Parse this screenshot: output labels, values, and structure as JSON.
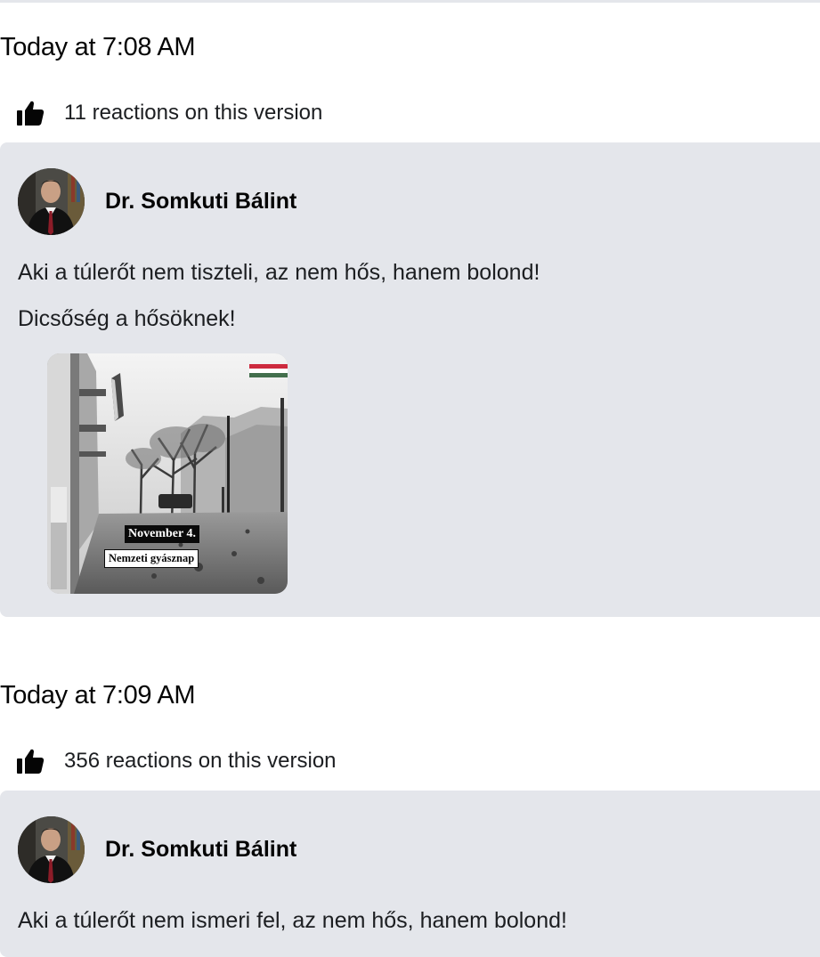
{
  "versions": [
    {
      "timestamp": "Today at 7:08 AM",
      "reactions": "11 reactions on this version",
      "author": "Dr. Somkuti Bálint",
      "lines": [
        "Aki a túlerőt nem tiszteli, az nem hős, hanem bolond!",
        "Dicsőség a hősöknek!"
      ],
      "image": {
        "caption_date": "November 4.",
        "caption_title": "Nemzeti gyásznap"
      }
    },
    {
      "timestamp": "Today at 7:09 AM",
      "reactions": "356 reactions on this version",
      "author": "Dr. Somkuti Bálint",
      "lines": [
        "Aki a túlerőt nem ismeri fel, az nem hős, hanem bolond!"
      ]
    }
  ],
  "icons": {
    "like": "thumbs-up-icon"
  },
  "colors": {
    "card_background": "#e4e6eb",
    "flag_red": "#cd2a3e",
    "flag_green": "#436f4d"
  }
}
